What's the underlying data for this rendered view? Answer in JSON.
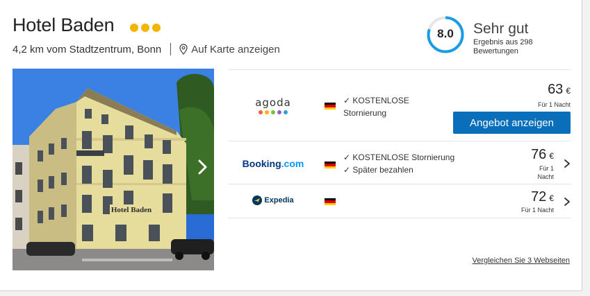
{
  "hotel": {
    "name": "Hotel Baden",
    "stars": 3,
    "distance": "4,2 km vom Stadtzentrum, Bonn",
    "map_link": "Auf Karte anzeigen"
  },
  "rating": {
    "score": "8.0",
    "label": "Sehr gut",
    "subtext": "Ergebnis aus 298 Bewertungen",
    "ring_fraction": 0.8,
    "ring_color": "#1a9be5"
  },
  "photo": {
    "sign_text": "Hotel Baden"
  },
  "deals": [
    {
      "provider": "agoda",
      "provider_icon": "agoda-logo",
      "flag": "de-flag",
      "cancel_line1": "KOSTENLOSE",
      "cancel_line2": "Stornierung",
      "price": "63",
      "currency": "€",
      "per_night": "Für 1 Nacht",
      "button": "Angebot anzeigen"
    },
    {
      "provider_main": "Booking",
      "provider_suffix": ".com",
      "provider_icon": "booking-logo",
      "flag": "de-flag",
      "cancel_line1": "KOSTENLOSE Stornierung",
      "cancel_line2": "Später bezahlen",
      "price": "76",
      "currency": "€",
      "per_night_1": "Für 1",
      "per_night_2": "Nacht"
    },
    {
      "provider": "Expedia",
      "provider_icon": "expedia-logo",
      "flag": "de-flag",
      "price": "72",
      "currency": "€",
      "per_night": "Für 1 Nacht"
    }
  ],
  "compare_link": "Vergleichen Sie 3 Webseiten",
  "colors": {
    "accent_button": "#0a6fba",
    "star": "#f5b400",
    "booking_blue": "#003580",
    "booking_light": "#0896ff"
  }
}
